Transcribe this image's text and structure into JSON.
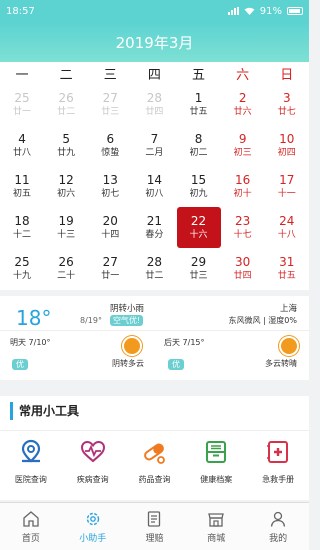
{
  "status": {
    "time": "18:57",
    "battery": "91%"
  },
  "header": {
    "title": "2019年3月"
  },
  "calendar": {
    "weekdays": [
      "一",
      "二",
      "三",
      "四",
      "五",
      "六",
      "日"
    ],
    "weeks": [
      [
        {
          "d": "25",
          "l": "廿一",
          "prev": true
        },
        {
          "d": "26",
          "l": "廿二",
          "prev": true
        },
        {
          "d": "27",
          "l": "廿三",
          "prev": true
        },
        {
          "d": "28",
          "l": "廿四",
          "prev": true
        },
        {
          "d": "1",
          "l": "廿五"
        },
        {
          "d": "2",
          "l": "廿六"
        },
        {
          "d": "3",
          "l": "廿七"
        }
      ],
      [
        {
          "d": "4",
          "l": "廿八"
        },
        {
          "d": "5",
          "l": "廿九"
        },
        {
          "d": "6",
          "l": "惊蛰"
        },
        {
          "d": "7",
          "l": "二月"
        },
        {
          "d": "8",
          "l": "初二"
        },
        {
          "d": "9",
          "l": "初三"
        },
        {
          "d": "10",
          "l": "初四"
        }
      ],
      [
        {
          "d": "11",
          "l": "初五"
        },
        {
          "d": "12",
          "l": "初六"
        },
        {
          "d": "13",
          "l": "初七"
        },
        {
          "d": "14",
          "l": "初八"
        },
        {
          "d": "15",
          "l": "初九"
        },
        {
          "d": "16",
          "l": "初十"
        },
        {
          "d": "17",
          "l": "十一"
        }
      ],
      [
        {
          "d": "18",
          "l": "十二"
        },
        {
          "d": "19",
          "l": "十三"
        },
        {
          "d": "20",
          "l": "十四"
        },
        {
          "d": "21",
          "l": "春分"
        },
        {
          "d": "22",
          "l": "十六",
          "today": true
        },
        {
          "d": "23",
          "l": "十七"
        },
        {
          "d": "24",
          "l": "十八"
        }
      ],
      [
        {
          "d": "25",
          "l": "十九"
        },
        {
          "d": "26",
          "l": "二十"
        },
        {
          "d": "27",
          "l": "廿一"
        },
        {
          "d": "28",
          "l": "廿二"
        },
        {
          "d": "29",
          "l": "廿三"
        },
        {
          "d": "30",
          "l": "廿四"
        },
        {
          "d": "31",
          "l": "廿五"
        }
      ]
    ]
  },
  "weather": {
    "temp": "18°",
    "desc": "阴转小雨",
    "date": "8/19°",
    "aqi": "空气优!",
    "city": "上海",
    "wind": "东风微风 | 湿度0%",
    "tomorrow": {
      "label": "明天 7/10°",
      "badge": "优",
      "cond": "阴转多云"
    },
    "after": {
      "label": "后天 7/15°",
      "badge": "优",
      "cond": "多云转晴"
    }
  },
  "tools": {
    "title": "常用小工具",
    "items": [
      {
        "label": "医院查询",
        "icon": "location-pin-icon"
      },
      {
        "label": "疾病查询",
        "icon": "heartbeat-icon"
      },
      {
        "label": "药品查询",
        "icon": "pill-icon"
      },
      {
        "label": "健康档案",
        "icon": "archive-box-icon"
      },
      {
        "label": "急救手册",
        "icon": "first-aid-icon"
      }
    ]
  },
  "tabs": [
    {
      "label": "首页",
      "icon": "home-icon"
    },
    {
      "label": "小助手",
      "icon": "assistant-gear-icon",
      "active": true
    },
    {
      "label": "理赔",
      "icon": "claim-document-icon"
    },
    {
      "label": "商城",
      "icon": "shop-icon"
    },
    {
      "label": "我的",
      "icon": "user-icon"
    }
  ],
  "colors": {
    "accent": "#28a3de",
    "header": "#5cd3d1",
    "today": "#c4121b",
    "weekend": "#d72222"
  }
}
